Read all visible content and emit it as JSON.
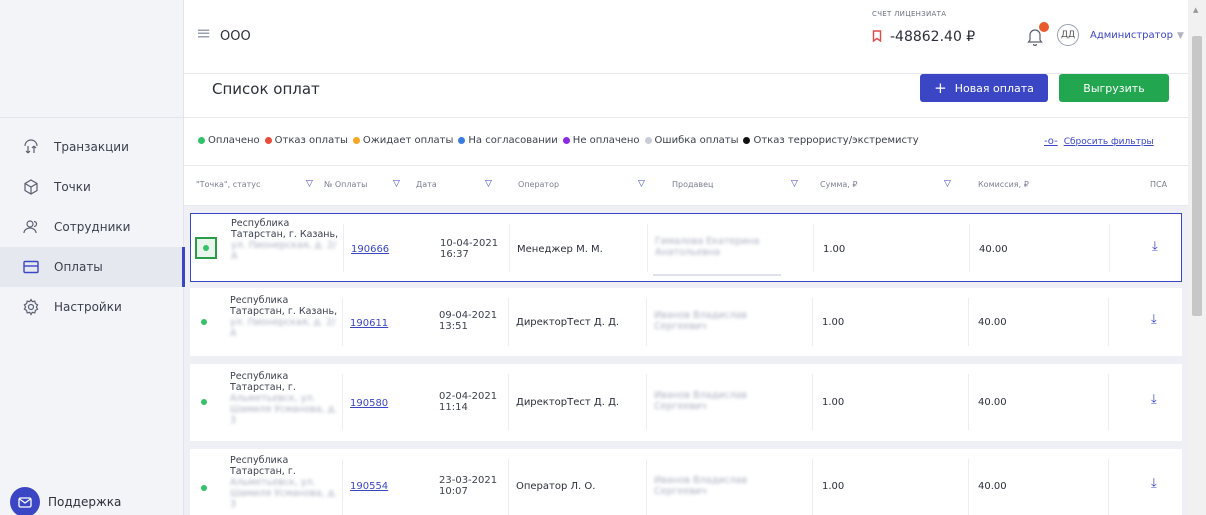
{
  "header": {
    "org_name": "ООО",
    "account_label": "СЧЕТ ЛИЦЕНЗИАТА",
    "account_value": "-48862.40 ₽",
    "avatar_initials": "ДД",
    "user_role": "Администратор"
  },
  "sidebar": {
    "items": [
      {
        "label": "Транзакции",
        "icon": "transactions-icon"
      },
      {
        "label": "Точки",
        "icon": "cube-icon"
      },
      {
        "label": "Сотрудники",
        "icon": "users-icon"
      },
      {
        "label": "Оплаты",
        "icon": "card-icon",
        "active": true
      },
      {
        "label": "Настройки",
        "icon": "gear-icon"
      }
    ],
    "support_label": "Поддержка"
  },
  "page": {
    "title": "Список оплат",
    "new_payment_label": "Новая оплата",
    "export_label": "Выгрузить"
  },
  "filters": {
    "legend": [
      {
        "label": "Оплачено",
        "color": "#35c06a"
      },
      {
        "label": "Отказ оплаты",
        "color": "#e84b3a"
      },
      {
        "label": "Ожидает оплаты",
        "color": "#f5a623"
      },
      {
        "label": "На согласовании",
        "color": "#3a7be0"
      },
      {
        "label": "Не оплачено",
        "color": "#8a2be2"
      },
      {
        "label": "Ошибка оплаты",
        "color": "#c9ccd6"
      },
      {
        "label": "Отказ террористу/экстремисту",
        "color": "#111111"
      }
    ],
    "reset_label": "Сбросить фильтры"
  },
  "table": {
    "columns": [
      "\"Точка\", статус",
      "№ Оплаты",
      "Дата",
      "Оператор",
      "Продавец",
      "Сумма, ₽",
      "Комиссия, ₽",
      "ПСА"
    ],
    "rows": [
      {
        "addr_visible": "Республика Татарстан, г. Казань,",
        "addr_hidden": "ул. Пионерская, д. 2/А",
        "number": "190666",
        "date": "10-04-2021",
        "time": "16:37",
        "operator": "Менеджер М. М.",
        "seller": "Гималова Екатерина Анатольевна",
        "sum": "1.00",
        "commission": "40.00"
      },
      {
        "addr_visible": "Республика Татарстан, г. Казань,",
        "addr_hidden": "ул. Пионерская, д. 2/А",
        "number": "190611",
        "date": "09-04-2021",
        "time": "13:51",
        "operator": "ДиректорТест Д. Д.",
        "seller": "Иванов Владислав Сергеевич",
        "sum": "1.00",
        "commission": "40.00"
      },
      {
        "addr_visible": "Республика Татарстан, г.",
        "addr_hidden": "Альметьевск, ул. Шамиля Усманова, д. 3",
        "number": "190580",
        "date": "02-04-2021",
        "time": "11:14",
        "operator": "ДиректорТест Д. Д.",
        "seller": "Иванов Владислав Сергеевич",
        "sum": "1.00",
        "commission": "40.00"
      },
      {
        "addr_visible": "Республика Татарстан, г.",
        "addr_hidden": "Альметьевск, ул. Шамиля Усманова, д. 3",
        "number": "190554",
        "date": "23-03-2021",
        "time": "10:07",
        "operator": "Оператор Л. О.",
        "seller": "Иванов Владислав Сергеевич",
        "sum": "1.00",
        "commission": "40.00"
      }
    ]
  },
  "colors": {
    "accent": "#3b46c4",
    "green": "#22a64f",
    "paid": "#35c06a",
    "alert": "#e24a4a"
  }
}
